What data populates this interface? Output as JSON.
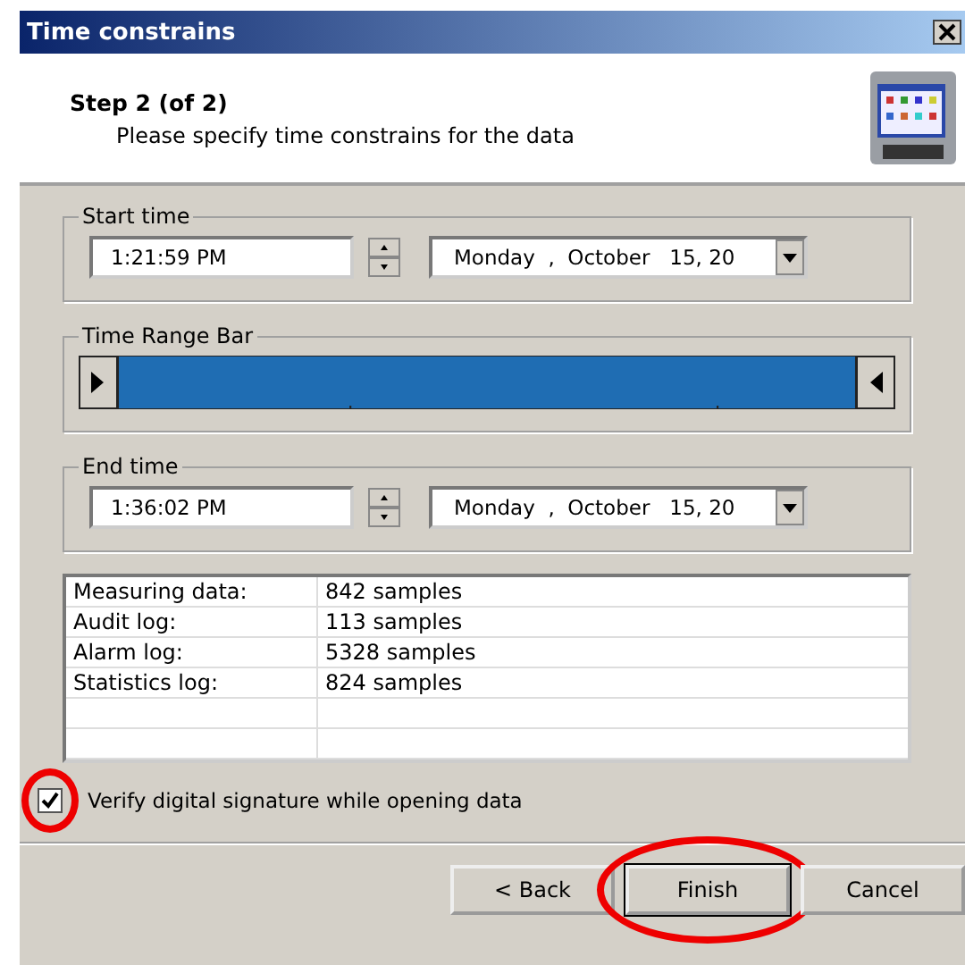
{
  "window": {
    "title": "Time constrains"
  },
  "header": {
    "step": "Step 2 (of 2)",
    "description": "Please specify time constrains for the data"
  },
  "start_time": {
    "label": "Start time",
    "time": "1:21:59 PM",
    "date": "Monday  ,  October   15, 20"
  },
  "time_range_bar": {
    "label": "Time Range Bar"
  },
  "end_time": {
    "label": "End time",
    "time": "1:36:02 PM",
    "date": "Monday  ,  October   15, 20"
  },
  "summary": {
    "rows": [
      {
        "name": "Measuring data:",
        "value": "842 samples"
      },
      {
        "name": "Audit log:",
        "value": "113 samples"
      },
      {
        "name": "Alarm log:",
        "value": "5328 samples"
      },
      {
        "name": "Statistics log:",
        "value": "824 samples"
      }
    ]
  },
  "verify_checkbox": {
    "label": "Verify digital signature while opening data",
    "checked": true,
    "highlighted": true
  },
  "buttons": [
    {
      "label": "< Back",
      "default": false,
      "highlighted": false
    },
    {
      "label": "Finish",
      "default": true,
      "highlighted": true
    },
    {
      "label": "Cancel",
      "default": false,
      "highlighted": false
    }
  ]
}
